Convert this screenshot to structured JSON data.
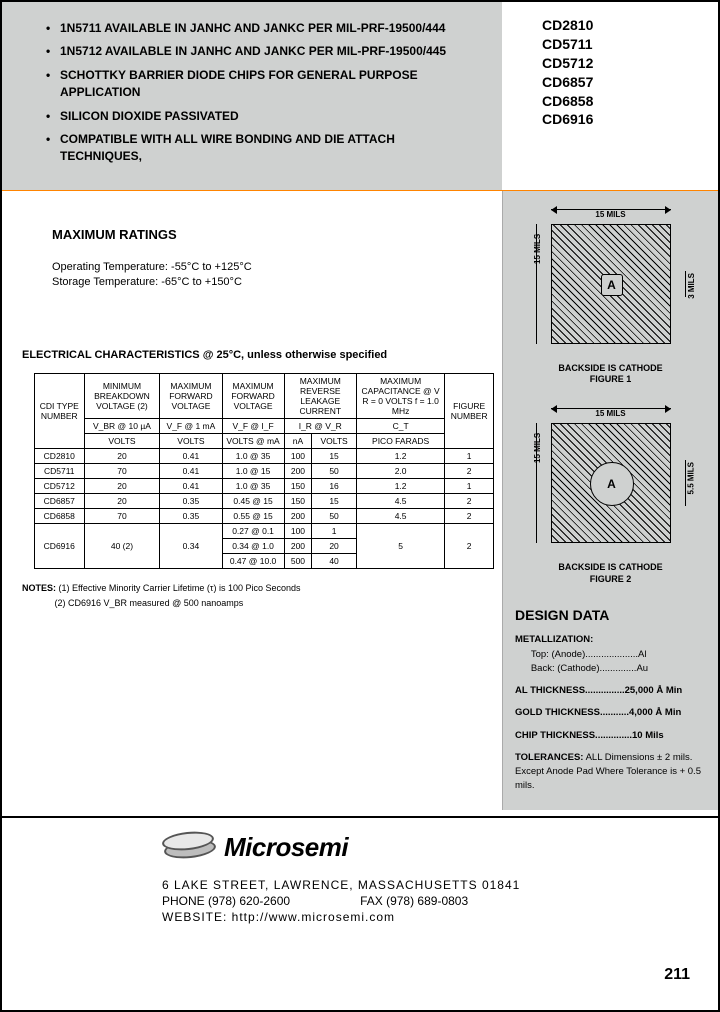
{
  "features": [
    "1N5711 AVAILABLE IN JANHC AND JANKC PER MIL-PRF-19500/444",
    "1N5712 AVAILABLE IN JANHC AND JANKC PER MIL-PRF-19500/445",
    "SCHOTTKY BARRIER DIODE CHIPS FOR GENERAL PURPOSE APPLICATION",
    "SILICON DIOXIDE PASSIVATED",
    "COMPATIBLE WITH ALL WIRE BONDING AND DIE ATTACH TECHNIQUES,"
  ],
  "part_numbers": [
    "CD2810",
    "CD5711",
    "CD5712",
    "CD6857",
    "CD6858",
    "CD6916"
  ],
  "max_ratings": {
    "heading": "MAXIMUM RATINGS",
    "operating": "Operating Temperature: -55°C to +125°C",
    "storage": "Storage Temperature: -65°C to +150°C"
  },
  "ec_heading": "ELECTRICAL CHARACTERISTICS @ 25°C, unless otherwise specified",
  "ec_headers": {
    "r1": [
      "CDI TYPE NUMBER",
      "MINIMUM BREAKDOWN VOLTAGE (2)",
      "MAXIMUM FORWARD VOLTAGE",
      "MAXIMUM FORWARD VOLTAGE",
      "MAXIMUM REVERSE LEAKAGE CURRENT",
      "MAXIMUM CAPACITANCE @ V R = 0 VOLTS f = 1.0 MHz",
      "FIGURE NUMBER"
    ],
    "r2": [
      "",
      "V_BR @ 10 µA",
      "V_F @ 1 mA",
      "V_F @ I_F",
      "I_R @ V_R",
      "C_T",
      ""
    ],
    "r3": [
      "",
      "VOLTS",
      "VOLTS",
      "VOLTS @ mA",
      "nA",
      "VOLTS",
      "PICO FARADS",
      ""
    ]
  },
  "ec_rows": [
    {
      "type": "CD2810",
      "vbr": "20",
      "vf1": "0.41",
      "vfif": "1.0 @ 35",
      "ir": "100",
      "vr": "15",
      "ct": "1.2",
      "fig": "1"
    },
    {
      "type": "CD5711",
      "vbr": "70",
      "vf1": "0.41",
      "vfif": "1.0 @ 15",
      "ir": "200",
      "vr": "50",
      "ct": "2.0",
      "fig": "2"
    },
    {
      "type": "CD5712",
      "vbr": "20",
      "vf1": "0.41",
      "vfif": "1.0 @ 35",
      "ir": "150",
      "vr": "16",
      "ct": "1.2",
      "fig": "1"
    },
    {
      "type": "CD6857",
      "vbr": "20",
      "vf1": "0.35",
      "vfif": "0.45 @ 15",
      "ir": "150",
      "vr": "15",
      "ct": "4.5",
      "fig": "2"
    },
    {
      "type": "CD6858",
      "vbr": "70",
      "vf1": "0.35",
      "vfif": "0.55 @ 15",
      "ir": "200",
      "vr": "50",
      "ct": "4.5",
      "fig": "2"
    }
  ],
  "ec_row6": {
    "type": "CD6916",
    "vbr": "40 (2)",
    "vf1": "0.34",
    "lines": [
      {
        "vfif": "0.27 @ 0.1",
        "ir": "100",
        "vr": "1"
      },
      {
        "vfif": "0.34 @ 1.0",
        "ir": "200",
        "vr": "20"
      },
      {
        "vfif": "0.47 @ 10.0",
        "ir": "500",
        "vr": "40"
      }
    ],
    "ct": "5",
    "fig": "2"
  },
  "notes": {
    "label": "NOTES:",
    "n1": "(1) Effective Minority Carrier Lifetime (τ) is 100 Pico Seconds",
    "n2": "(2) CD6916 V_BR measured @ 500 nanoamps"
  },
  "figures": {
    "dim_top": "15 MILS",
    "dim_left": "15 MILS",
    "dim_right1": "3 MILS",
    "dim_right2": "5.5 MILS",
    "pad": "A",
    "cap1a": "BACKSIDE IS CATHODE",
    "cap1b": "FIGURE 1",
    "cap2a": "BACKSIDE IS CATHODE",
    "cap2b": "FIGURE 2"
  },
  "design": {
    "heading": "DESIGN DATA",
    "metal_label": "METALLIZATION:",
    "metal_top": "Top: (Anode)....................Al",
    "metal_back": "Back: (Cathode)..............Au",
    "al": "AL THICKNESS...............25,000 Å Min",
    "gold": "GOLD THICKNESS...........4,000 Å Min",
    "chip": "CHIP THICKNESS..............10 Mils",
    "tol_label": "TOLERANCES:",
    "tol_text": "ALL Dimensions ± 2 mils. Except Anode Pad Where Tolerance is + 0.5 mils."
  },
  "footer": {
    "company": "Microsemi",
    "address": "6  LAKE  STREET,  LAWRENCE,  MASSACHUSETTS  01841",
    "phone": "PHONE (978) 620-2600",
    "fax": "FAX (978) 689-0803",
    "website": "WEBSITE:  http://www.microsemi.com",
    "page": "211"
  }
}
